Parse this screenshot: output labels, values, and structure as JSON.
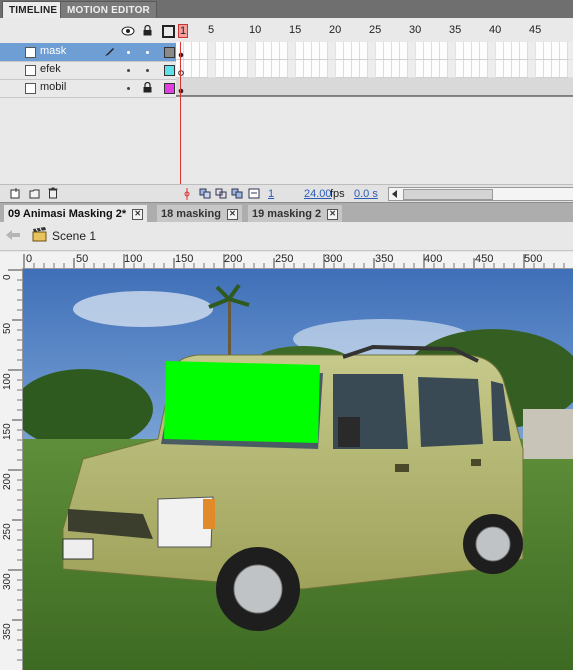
{
  "panel_tabs": {
    "timeline": "TIMELINE",
    "motion_editor": "MOTION EDITOR"
  },
  "timeline": {
    "frame_numbers": [
      "1",
      "5",
      "10",
      "15",
      "20",
      "25",
      "30",
      "35",
      "40",
      "45"
    ],
    "layers": [
      {
        "name": "mask",
        "selected": true,
        "color": "#8a8a8a"
      },
      {
        "name": "efek",
        "selected": false,
        "color": "#5fe0e8"
      },
      {
        "name": "mobil",
        "selected": false,
        "color": "#e040e0"
      }
    ],
    "current_frame": "1",
    "fps": "24.00",
    "fps_unit": "fps",
    "time": "0.0 s"
  },
  "doc_tabs": [
    "09 Animasi Masking 2*",
    "18 masking",
    "19 masking 2"
  ],
  "scene": {
    "label": "Scene 1"
  },
  "stage": {
    "h_ruler": [
      "0",
      "50",
      "100",
      "150",
      "200",
      "250",
      "300",
      "350",
      "400",
      "450",
      "500"
    ],
    "v_ruler": [
      "0",
      "50",
      "100",
      "150",
      "200",
      "250",
      "300",
      "350"
    ],
    "mask_color": "#00ff00"
  }
}
